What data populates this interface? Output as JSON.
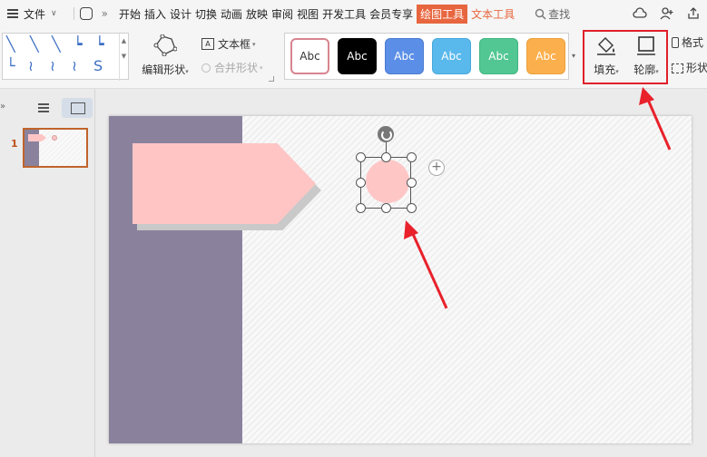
{
  "menubar": {
    "file_label": "文件",
    "tabs": [
      "开始",
      "插入",
      "设计",
      "切换",
      "动画",
      "放映",
      "审阅",
      "视图",
      "开发工具",
      "会员专享"
    ],
    "active_tab": "绘图工具",
    "text_tool_tab": "文本工具",
    "search_label": "查找"
  },
  "ribbon": {
    "edit_shape_label": "编辑形状",
    "text_box_label": "文本框",
    "merge_shapes_label": "合并形状",
    "style_preset_label": "Abc",
    "fill_label": "填充",
    "outline_label": "轮廓",
    "format_label": "格式",
    "shape_effects_label": "形状"
  },
  "style_presets": [
    {
      "label": "Abc",
      "bg": "#ffffff",
      "fg": "#333333",
      "border": "#d8848f"
    },
    {
      "label": "Abc",
      "bg": "#000000",
      "fg": "#ffffff",
      "border": "#000000"
    },
    {
      "label": "Abc",
      "bg": "#5b8ee6",
      "fg": "#ffffff",
      "border": "#4a7bd1"
    },
    {
      "label": "Abc",
      "bg": "#5ab9ec",
      "fg": "#ffffff",
      "border": "#47a8dc"
    },
    {
      "label": "Abc",
      "bg": "#52c793",
      "fg": "#ffffff",
      "border": "#41b680"
    },
    {
      "label": "Abc",
      "bg": "#fcb04d",
      "fg": "#ffffff",
      "border": "#eaa03c"
    }
  ],
  "slides_pane": {
    "slide_number": "1"
  },
  "colors": {
    "accent_tab": "#e8663f",
    "slide_band": "#8a829d",
    "shape_pink": "#ffc5c5",
    "highlight_red": "#e0202a"
  }
}
